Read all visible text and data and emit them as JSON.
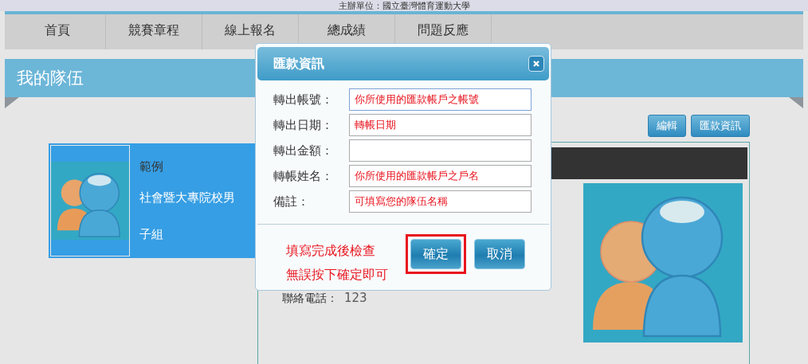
{
  "banner": {
    "text": "主辦單位：國立臺灣體育運動大學"
  },
  "nav": [
    {
      "label": "首頁",
      "selected": false
    },
    {
      "label": "競賽章程",
      "selected": false
    },
    {
      "label": "線上報名",
      "selected": false
    },
    {
      "label": "總成績",
      "selected": false
    },
    {
      "label": "問題反應",
      "selected": false
    }
  ],
  "page_title": "我的隊伍",
  "actions": [
    "編輯",
    "匯款資訊"
  ],
  "team_card": {
    "name": "範例",
    "group": "社會暨大專院校男子組",
    "selected": true
  },
  "detail": {
    "contact_label": "聯絡電話：",
    "contact_value": "123"
  },
  "dialog": {
    "title": "匯款資訊",
    "fields": [
      {
        "label": "轉出帳號：",
        "value": "你所使用的匯款帳戶之帳號",
        "focused": true
      },
      {
        "label": "轉出日期：",
        "value": "轉帳日期",
        "focused": false
      },
      {
        "label": "轉出金額：",
        "focused": false
      },
      {
        "label": "轉帳姓名：",
        "value": "你所使用的匯款帳戶之戶名",
        "focused": false
      },
      {
        "label": "備註：",
        "value": "可填寫您的隊伍名稱",
        "focused": false
      }
    ],
    "note": [
      "填寫完成後檢查",
      "無誤按下確定即可"
    ],
    "buttons": [
      {
        "label": "確定",
        "highlighted": true
      },
      {
        "label": "取消",
        "highlighted": false
      }
    ]
  }
}
